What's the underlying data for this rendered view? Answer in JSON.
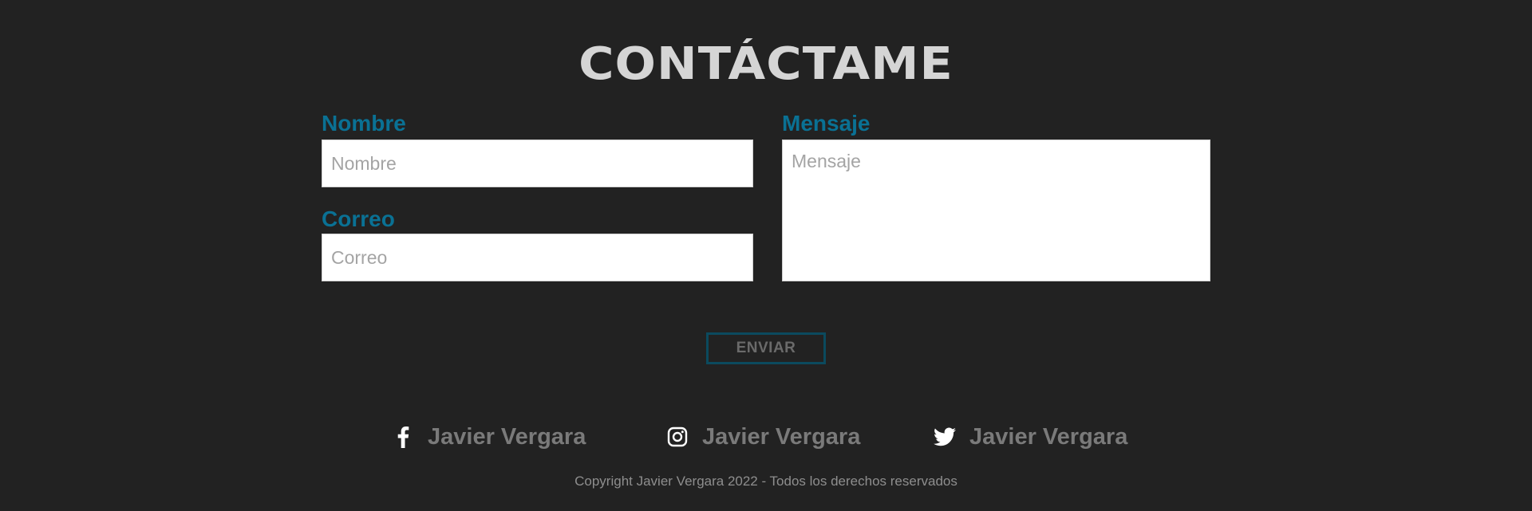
{
  "contact": {
    "title": "CONTÁCTAME",
    "name_label": "Nombre",
    "name_placeholder": "Nombre",
    "email_label": "Correo",
    "email_placeholder": "Correo",
    "message_label": "Mensaje",
    "message_placeholder": "Mensaje",
    "send_label": "ENVIAR"
  },
  "social": [
    {
      "icon": "facebook-icon",
      "name": "Javier Vergara"
    },
    {
      "icon": "instagram-icon",
      "name": "Javier Vergara"
    },
    {
      "icon": "twitter-icon",
      "name": "Javier Vergara"
    }
  ],
  "footer": {
    "copyright": "Copyright Javier Vergara 2022 - Todos los derechos reservados"
  },
  "colors": {
    "background": "#222222",
    "accent": "#0a7194",
    "title": "#d5d5d5",
    "button_border": "#0b4a5e",
    "muted_text": "#7a7a7a"
  }
}
